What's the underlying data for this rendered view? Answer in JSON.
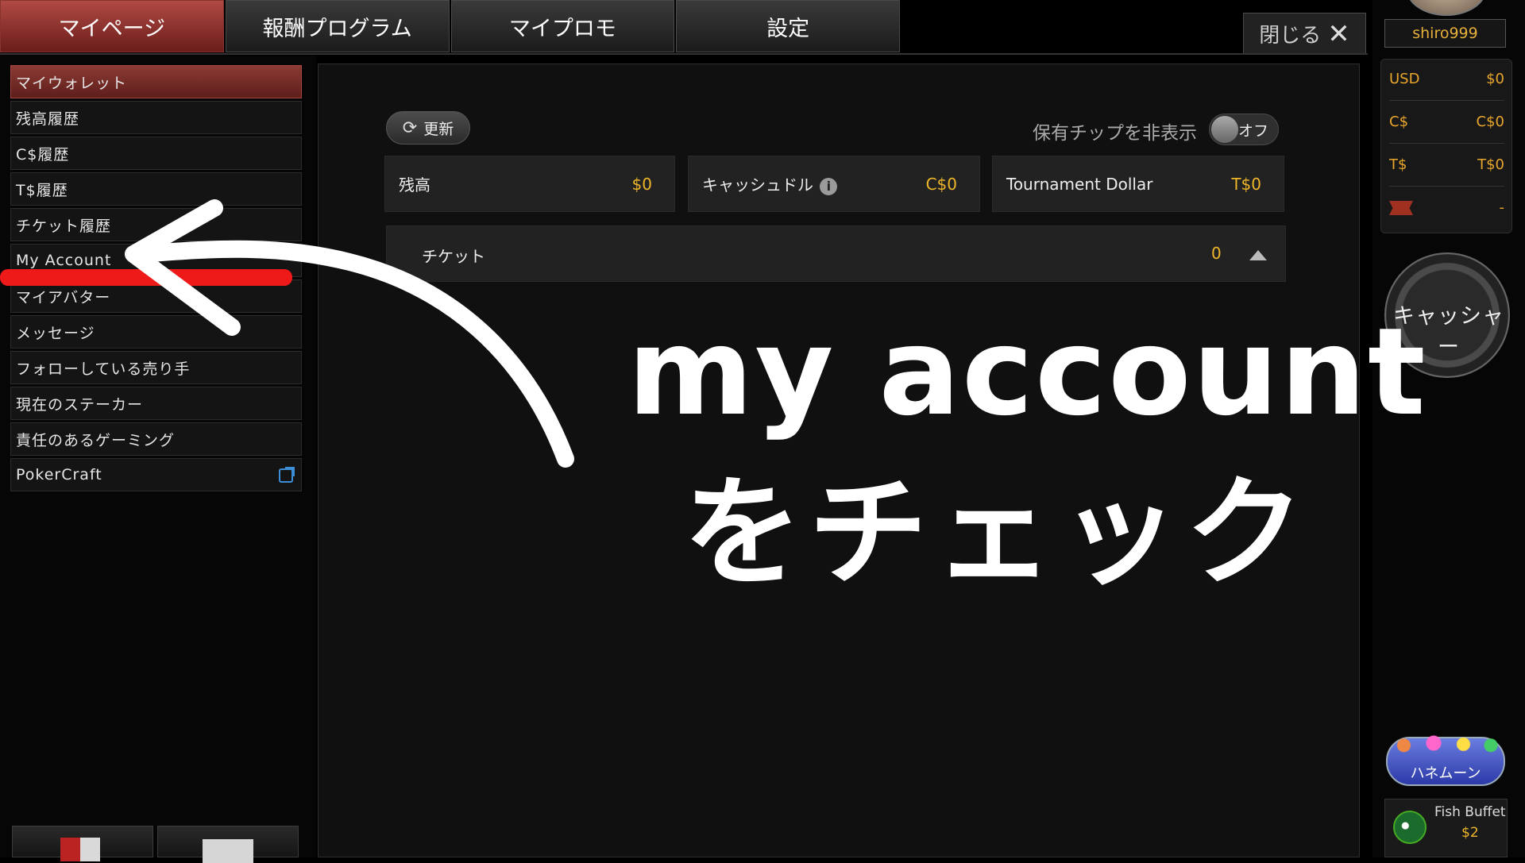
{
  "tabs": [
    "マイページ",
    "報酬プログラム",
    "マイプロモ",
    "設定"
  ],
  "close": {
    "label": "閉じる"
  },
  "sidebar": {
    "items": [
      "マイウォレット",
      "残高履歴",
      "C$履歴",
      "T$履歴",
      "チケット履歴",
      "My Account",
      "マイアバター",
      "メッセージ",
      "フォローしている売り手",
      "現在のステーカー",
      "責任のあるゲーミング",
      "PokerCraft"
    ]
  },
  "main": {
    "refresh_label": "更新",
    "hide_chips_label": "保有チップを非表示",
    "toggle_label": "オフ",
    "balances": [
      {
        "label": "残高",
        "value": "$0"
      },
      {
        "label": "キャッシュドル",
        "value": "C$0"
      },
      {
        "label": "Tournament Dollar",
        "value": "T$0"
      }
    ],
    "tickets": {
      "label": "チケット",
      "value": "0"
    }
  },
  "right_panel": {
    "username": "shiro999",
    "wallet": [
      {
        "currency": "USD",
        "value": "$0"
      },
      {
        "currency": "C$",
        "value": "C$0"
      },
      {
        "currency": "T$",
        "value": "T$0"
      },
      {
        "currency": "",
        "value": "-"
      }
    ],
    "cashier_label": "キャッシャー",
    "promo_honeymoon": "ハネムーン",
    "promo_fish": {
      "name": "Fish Buffet",
      "value": "$2"
    }
  },
  "annotation": {
    "line1": "my account",
    "line2": "をチェック"
  },
  "colors": {
    "accent_red": "#8c3a34",
    "gold": "#f0b62a",
    "arrow": "#ffffff",
    "underline": "#ee1a1a"
  }
}
